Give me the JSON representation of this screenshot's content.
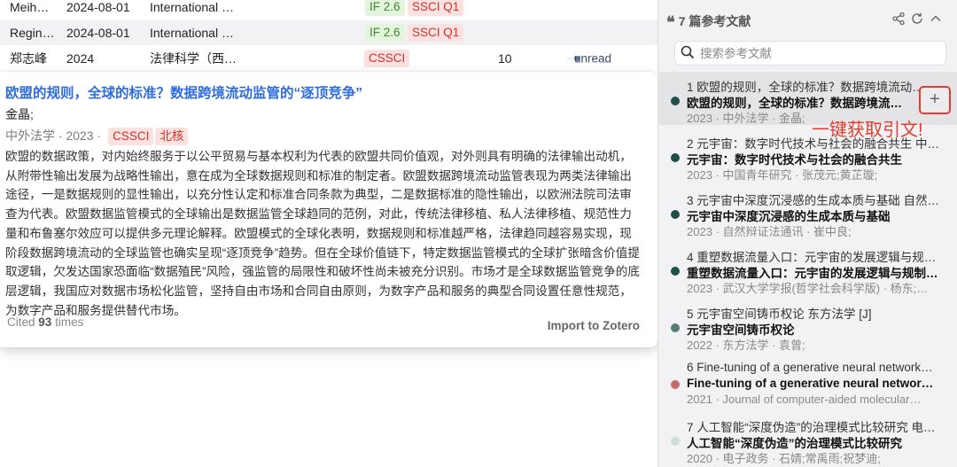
{
  "table": {
    "rows": [
      {
        "author": "Meih…",
        "date": "2024-08-01",
        "publication": "International …",
        "if": "IF 2.6",
        "tag": "SSCI Q1",
        "num": "",
        "status": ""
      },
      {
        "author": "Regin…",
        "date": "2024-08-01",
        "publication": "International …",
        "if": "IF 2.6",
        "tag": "SSCI Q1",
        "num": "",
        "status": ""
      },
      {
        "author": "郑志峰",
        "date": "2024",
        "publication": "法律科学（西…",
        "if": "",
        "tag": "CSSCI",
        "num": "10",
        "status": "unread"
      }
    ]
  },
  "card": {
    "title": "欧盟的规则，全球的标准？数据跨境流动监管的“逐顶竞争”",
    "author": "金晶;",
    "journal": "中外法学",
    "year": "2023",
    "separator": "·",
    "tags": [
      "CSSCI",
      "北核"
    ],
    "abstract": "欧盟的数据政策，对内始终服务于以公平贸易与基本权利为代表的欧盟共同价值观，对外则具有明确的法律输出动机，从附带性输出发展为战略性输出，意在成为全球数据规则和标准的制定者。欧盟数据跨境流动监管表现为两类法律输出途径，一是数据规则的显性输出，以充分性认定和标准合同条款为典型，二是数据标准的隐性输出，以欧洲法院司法审查为代表。欧盟数据监管模式的全球输出是数据监管全球趋同的范例，对此，传统法律移植、私人法律移植、规范性力量和布鲁塞尔效应可以提供多元理论解释。欧盟模式的全球化表明，数据规则和标准越严格，法律趋同越容易实现，现阶段数据跨境流动的全球监管也确实呈现“逐顶竞争”趋势。但在全球价值链下，特定数据监管模式的全球扩张暗含价值提取逻辑，欠发达国家恐面临“数据殖民”风险，强监管的局限性和破坏性尚未被充分识别。市场才是全球数据监管竞争的底层逻辑，我国应对数据市场松化监管，坚持自由市场和合同自由原则，为数字产品和服务的典型合同设置任意性规范，为数字产品和服务提供替代市场。",
    "cited_prefix": "Cited",
    "cited_count": "93",
    "cited_suffix": "times",
    "import_label": "Import to Zotero"
  },
  "panel": {
    "header_count": "7",
    "header_label": "篇参考文献",
    "icons": [
      "share-icon",
      "refresh-icon",
      "collapse-icon"
    ],
    "search_placeholder": "搜索参考文献",
    "refs": [
      {
        "line1": "1 欧盟的规则，全球的标准？数据跨境流动…",
        "line2": "欧盟的规则，全球的标准？数据跨境流动…",
        "line3": "2023 · 中外法学 · 金晶;",
        "dot": "#1e4f4a"
      },
      {
        "line1": "2 元宇宙：数字时代技术与社会的融合共生 中…",
        "line2": "元宇宙：数字时代技术与社会的融合共生",
        "line3": "2023 · 中国青年研究 · 张茂元;黄芷璇;",
        "dot": "#1e4f4a"
      },
      {
        "line1": "3 元宇宙中深度沉浸感的生成本质与基础 自然…",
        "line2": "元宇宙中深度沉浸感的生成本质与基础",
        "line3": "2023 · 自然辩证法通讯 · 崔中良;",
        "dot": "#1e4f4a"
      },
      {
        "line1": "4 重塑数据流量入口：元宇宙的发展逻辑与规…",
        "line2": "重塑数据流量入口：元宇宙的发展逻辑与规制…",
        "line3": "2023 · 武汉大学学报(哲学社会科学版) · 杨东;…",
        "dot": "#1e4f4a"
      },
      {
        "line1": "5 元宇宙空间铸币权论 东方法学 [J]",
        "line2": "元宇宙空间铸币权论",
        "line3": "2022 · 东方法学 · 袁曾;",
        "dot": "#557b7a"
      },
      {
        "line1": "6 Fine-tuning of a generative neural network…",
        "line2": "Fine-tuning of a generative neural networ…",
        "line3": "2021 · Journal of computer-aided molecular…",
        "dot": "#c46a6a"
      },
      {
        "line1": "7 人工智能“深度伪造”的治理模式比较研究 电…",
        "line2": "人工智能“深度伪造”的治理模式比较研究",
        "line3": "2020 · 电子政务 · 石婧;常禹雨;祝梦迪;",
        "dot": "#cfdcd8"
      }
    ],
    "add_label": "+",
    "annotation": "一键获取引文!"
  }
}
